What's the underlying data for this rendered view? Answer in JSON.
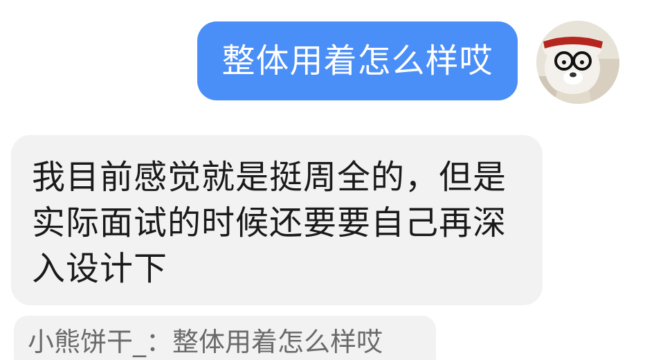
{
  "messages": {
    "outgoing": {
      "text": "整体用着怎么样哎"
    },
    "incoming": {
      "lines": [
        "我目前感觉就是挺周全的，但是",
        "实际面试的时候还要要自己再深",
        "入设计下"
      ]
    },
    "quote": {
      "text": "小熊饼干_：整体用着怎么样哎"
    }
  },
  "avatar": {
    "icon": "bear-avatar-icon"
  },
  "colors": {
    "outgoing_bubble": "#4a8ef7",
    "incoming_bubble": "#f2f2f2",
    "incoming_text": "#1a1a1a",
    "quote_text": "#6a6a6a"
  }
}
